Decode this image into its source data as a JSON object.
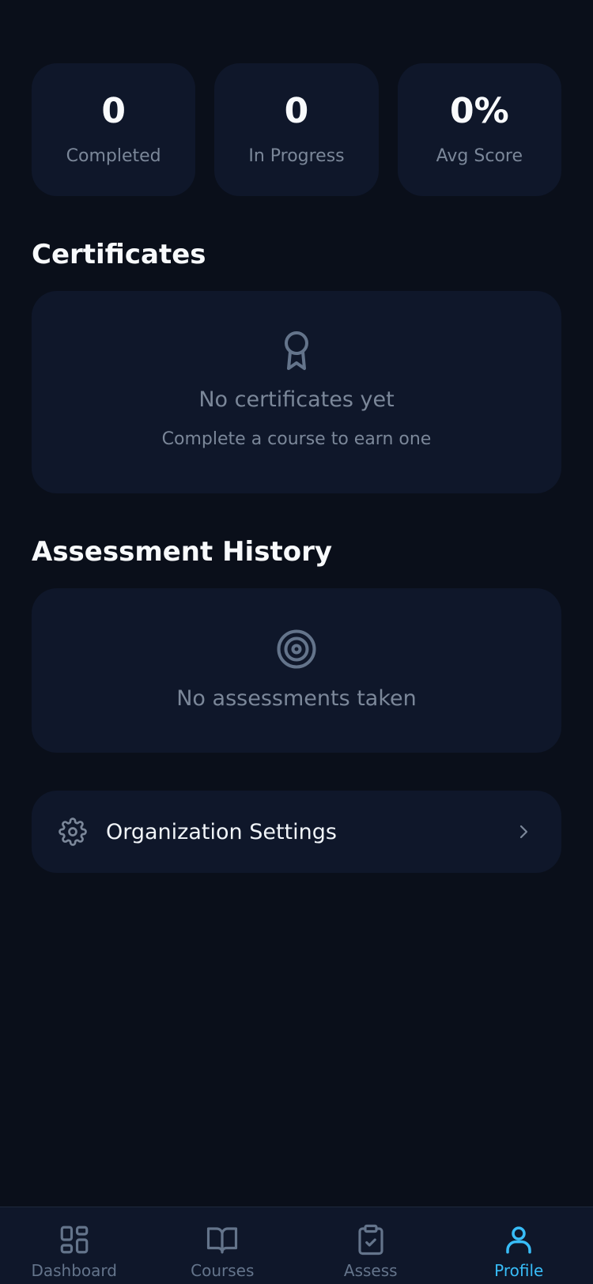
{
  "stats": [
    {
      "value": "0",
      "label": "Completed"
    },
    {
      "value": "0",
      "label": "In Progress"
    },
    {
      "value": "0%",
      "label": "Avg Score"
    }
  ],
  "certificates": {
    "title": "Certificates",
    "icon": "award-icon",
    "empty_title": "No certificates yet",
    "empty_subtitle": "Complete a course to earn one"
  },
  "assessments": {
    "title": "Assessment History",
    "icon": "target-icon",
    "empty_title": "No assessments taken"
  },
  "settings": {
    "label": "Organization Settings",
    "icon": "gear-icon"
  },
  "tabs": [
    {
      "label": "Dashboard",
      "icon": "grid-icon",
      "active": false
    },
    {
      "label": "Courses",
      "icon": "book-open-icon",
      "active": false
    },
    {
      "label": "Assess",
      "icon": "clipboard-check-icon",
      "active": false
    },
    {
      "label": "Profile",
      "icon": "user-icon",
      "active": true
    }
  ],
  "colors": {
    "background": "#0a0f1a",
    "card": "#0f172a",
    "muted": "#7b8799",
    "accent": "#38bdf8"
  }
}
